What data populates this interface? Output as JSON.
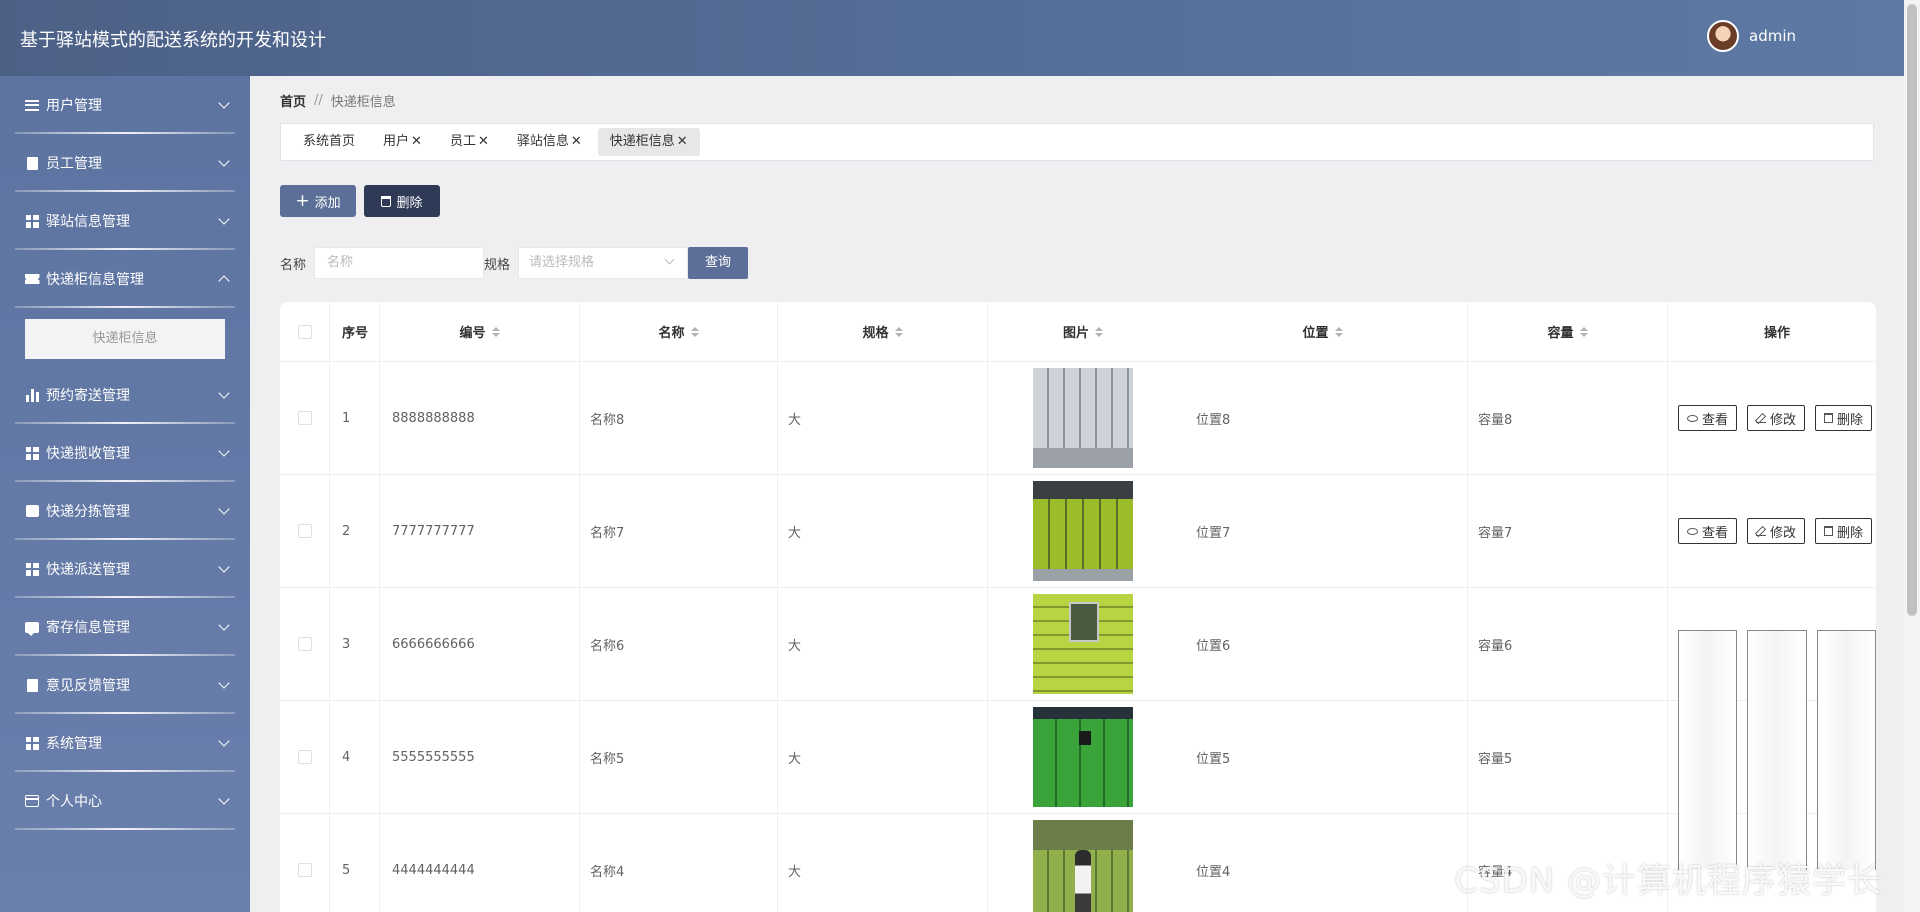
{
  "header": {
    "title": "基于驿站模式的配送系统的开发和设计",
    "username": "admin"
  },
  "sidebar": {
    "items": [
      {
        "label": "用户管理",
        "icon": "list-icon"
      },
      {
        "label": "员工管理",
        "icon": "clipboard-icon"
      },
      {
        "label": "驿站信息管理",
        "icon": "grid-icon"
      },
      {
        "label": "快递柜信息管理",
        "icon": "ticket-icon",
        "expanded": true
      },
      {
        "label": "预约寄送管理",
        "icon": "bar-chart-icon"
      },
      {
        "label": "快递揽收管理",
        "icon": "grid-icon"
      },
      {
        "label": "快递分拣管理",
        "icon": "printer-icon"
      },
      {
        "label": "快递派送管理",
        "icon": "grid-icon"
      },
      {
        "label": "寄存信息管理",
        "icon": "chat-icon"
      },
      {
        "label": "意见反馈管理",
        "icon": "document-icon"
      },
      {
        "label": "系统管理",
        "icon": "grid-icon"
      },
      {
        "label": "个人中心",
        "icon": "card-icon"
      }
    ],
    "submenu_item": "快递柜信息"
  },
  "breadcrumb": {
    "home": "首页",
    "separator": "//",
    "current": "快递柜信息"
  },
  "tabs": [
    {
      "label": "系统首页",
      "closable": false
    },
    {
      "label": "用户",
      "closable": true
    },
    {
      "label": "员工",
      "closable": true
    },
    {
      "label": "驿站信息",
      "closable": true
    },
    {
      "label": "快递柜信息",
      "closable": true,
      "active": true
    }
  ],
  "toolbar": {
    "add_label": "添加",
    "delete_label": "删除"
  },
  "search": {
    "name_label": "名称",
    "name_placeholder": "名称",
    "spec_label": "规格",
    "spec_placeholder": "请选择规格",
    "query_label": "查询"
  },
  "table": {
    "columns": [
      "序号",
      "编号",
      "名称",
      "规格",
      "图片",
      "位置",
      "容量",
      "操作"
    ],
    "rows": [
      {
        "index": "1",
        "code": "8888888888",
        "name": "名称8",
        "spec": "大",
        "location": "位置8",
        "capacity": "容量8"
      },
      {
        "index": "2",
        "code": "7777777777",
        "name": "名称7",
        "spec": "大",
        "location": "位置7",
        "capacity": "容量7"
      },
      {
        "index": "3",
        "code": "6666666666",
        "name": "名称6",
        "spec": "大",
        "location": "位置6",
        "capacity": "容量6"
      },
      {
        "index": "4",
        "code": "5555555555",
        "name": "名称5",
        "spec": "大",
        "location": "位置5",
        "capacity": "容量5"
      },
      {
        "index": "5",
        "code": "4444444444",
        "name": "名称4",
        "spec": "大",
        "location": "位置4",
        "capacity": "容量4"
      }
    ],
    "actions": {
      "view": "查看",
      "edit": "修改",
      "delete": "删除"
    }
  },
  "watermark": "CSDN @计算机程序猿学长",
  "colors": {
    "header": "#4d6187",
    "sidebar": "#5d73a0",
    "primary_button": "#5c6f99",
    "danger_button": "#2e3a56"
  }
}
